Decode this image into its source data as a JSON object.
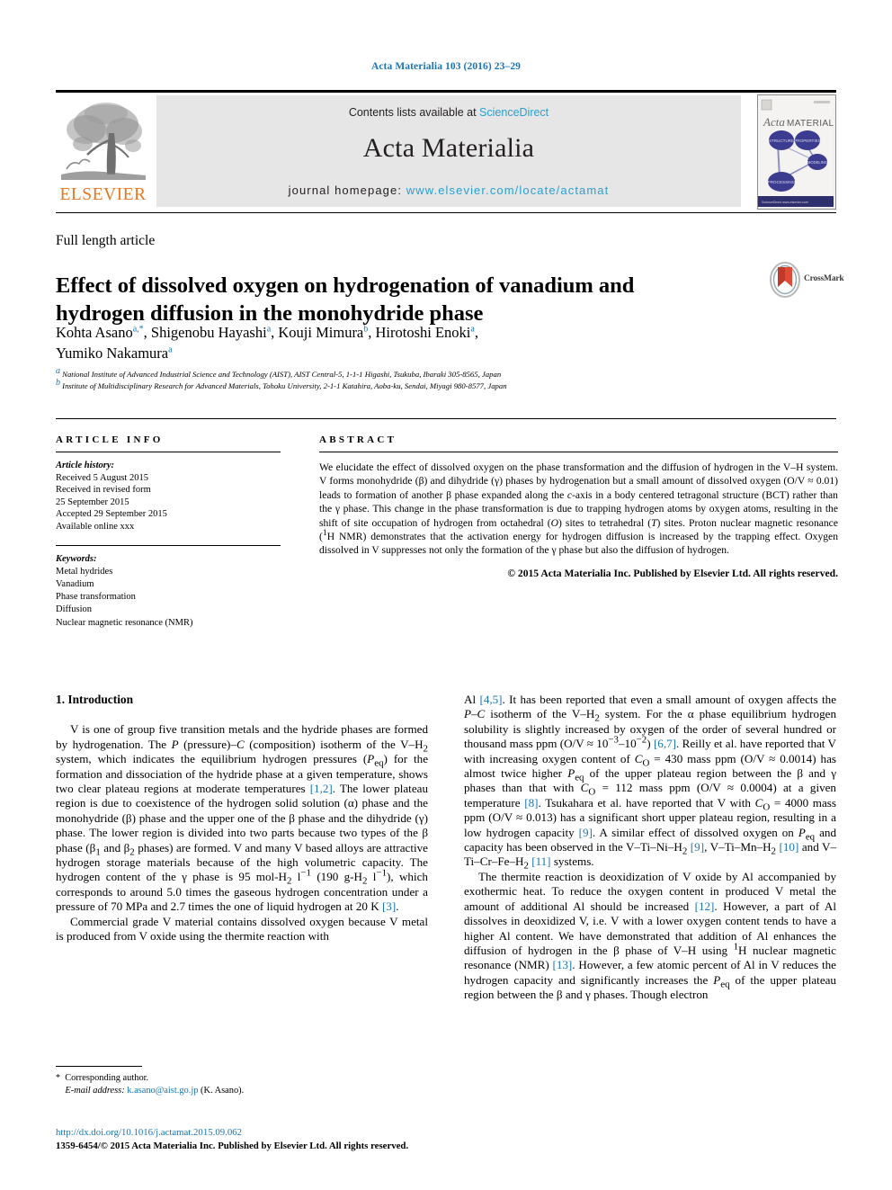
{
  "running_head": "Acta Materialia 103 (2016) 23–29",
  "masthead": {
    "contents_prefix": "Contents lists available at ",
    "sciencedirect": "ScienceDirect",
    "journal_title": "Acta Materialia",
    "homepage_prefix": "journal homepage: ",
    "homepage_url": "www.elsevier.com/locate/actamat",
    "publisher_logo_text": "ELSEVIER",
    "cover_title_a": "Acta",
    "cover_title_b": "MATERIALIA",
    "cover_nodes": [
      "STRUCTURE",
      "PROPERTIES",
      "MODELING",
      "PROCESSING"
    ]
  },
  "crossmark": {
    "label": "CrossMark"
  },
  "article": {
    "type": "Full length article",
    "title": "Effect of dissolved oxygen on hydrogenation of vanadium and hydrogen diffusion in the monohydride phase",
    "authors_line1_parts": [
      {
        "name": "Kohta Asano",
        "sup": "a,"
      },
      {
        "name": "Shigenobu Hayashi",
        "sup": "a"
      },
      {
        "name": "Kouji Mimura",
        "sup": "b"
      },
      {
        "name": "Hirotoshi Enoki",
        "sup": "a"
      }
    ],
    "authors_line2": {
      "name": "Yumiko Nakamura",
      "sup": "a"
    },
    "affiliations": [
      {
        "marker": "a",
        "text": "National Institute of Advanced Industrial Science and Technology (AIST), AIST Central-5, 1-1-1 Higashi, Tsukuba, Ibaraki 305-8565, Japan"
      },
      {
        "marker": "b",
        "text": "Institute of Multidisciplinary Research for Advanced Materials, Tohoku University, 2-1-1 Katahira, Aoba-ku, Sendai, Miyagi 980-8577, Japan"
      }
    ]
  },
  "article_info": {
    "heading": "ARTICLE INFO",
    "history_label": "Article history:",
    "history": [
      "Received 5 August 2015",
      "Received in revised form",
      "25 September 2015",
      "Accepted 29 September 2015",
      "Available online xxx"
    ],
    "keywords_label": "Keywords:",
    "keywords": [
      "Metal hydrides",
      "Vanadium",
      "Phase transformation",
      "Diffusion",
      "Nuclear magnetic resonance (NMR)"
    ]
  },
  "abstract": {
    "heading": "ABSTRACT",
    "copyright": "© 2015 Acta Materialia Inc. Published by Elsevier Ltd. All rights reserved."
  },
  "body": {
    "section_number_title": "1. Introduction"
  },
  "footnote": {
    "corresponding": "Corresponding author.",
    "email_label": "E-mail address:",
    "email": "k.asano@aist.go.jp",
    "email_owner": "(K. Asano)."
  },
  "footer": {
    "doi": "http://dx.doi.org/10.1016/j.actamat.2015.09.062",
    "issn_line": "1359-6454/© 2015 Acta Materialia Inc. Published by Elsevier Ltd. All rights reserved."
  },
  "colors": {
    "link": "#1b75b2",
    "sciencedirect": "#2a9fd0",
    "elsevier_orange": "#e87722",
    "band_gray": "#e6e6e6"
  }
}
